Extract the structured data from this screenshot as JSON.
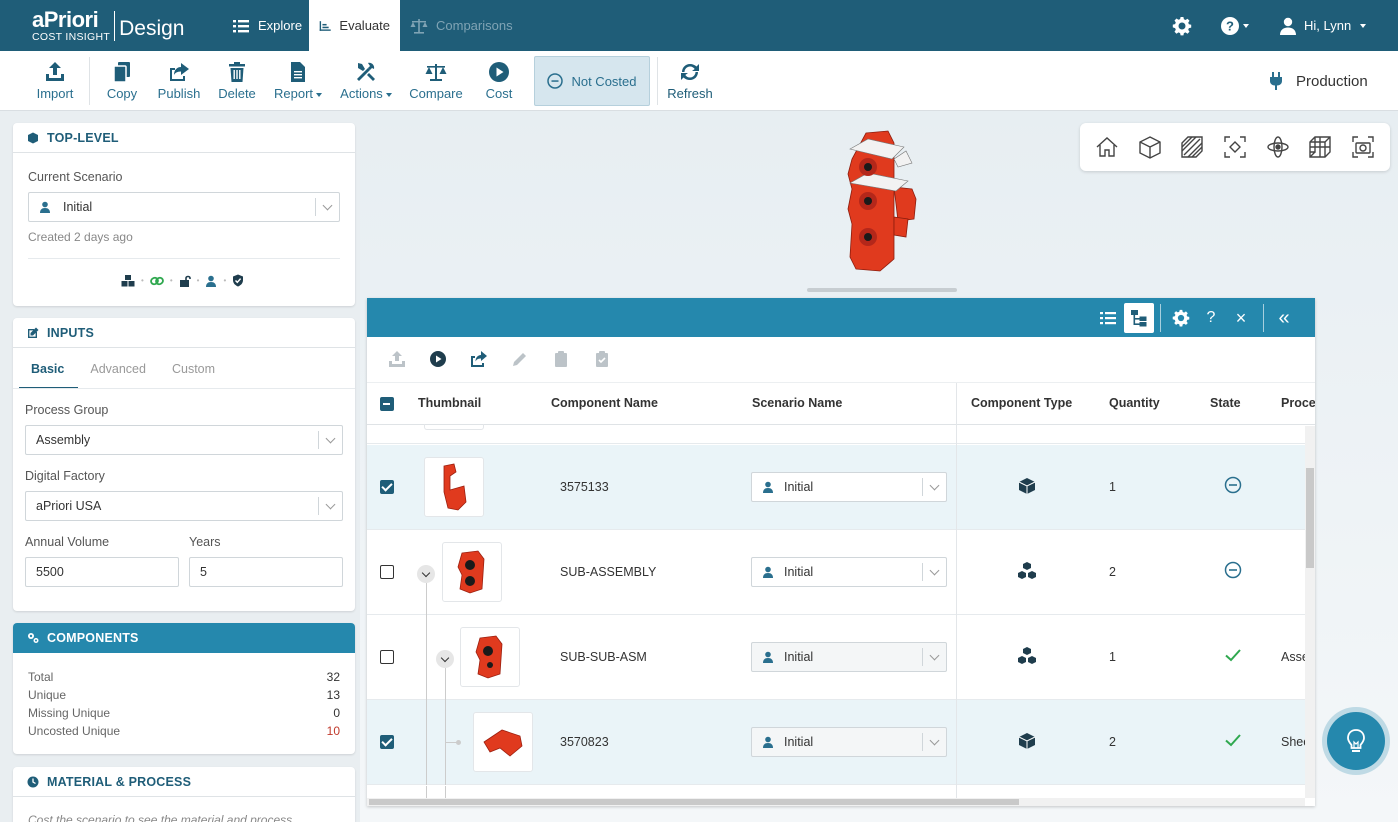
{
  "nav": {
    "brand_name": "aPriori",
    "brand_sub": "COST INSIGHT",
    "brand_product": "Design",
    "tabs": [
      {
        "label": "Explore"
      },
      {
        "label": "Evaluate"
      },
      {
        "label": "Comparisons"
      }
    ],
    "user_label": "Hi, Lynn"
  },
  "toolbar": {
    "import": "Import",
    "copy": "Copy",
    "publish": "Publish",
    "delete": "Delete",
    "report": "Report",
    "actions": "Actions",
    "compare": "Compare",
    "cost": "Cost",
    "status": "Not Costed",
    "refresh": "Refresh",
    "deployment": "Production"
  },
  "top_level": {
    "title": "TOP-LEVEL",
    "current_scenario_label": "Current Scenario",
    "current_scenario_value": "Initial",
    "created": "Created 2 days ago"
  },
  "inputs": {
    "title": "INPUTS",
    "tabs": [
      "Basic",
      "Advanced",
      "Custom"
    ],
    "process_group_label": "Process Group",
    "process_group_value": "Assembly",
    "digital_factory_label": "Digital Factory",
    "digital_factory_value": "aPriori USA",
    "annual_volume_label": "Annual Volume",
    "annual_volume_value": "5500",
    "years_label": "Years",
    "years_value": "5"
  },
  "components": {
    "title": "COMPONENTS",
    "rows": [
      {
        "label": "Total",
        "value": "32"
      },
      {
        "label": "Unique",
        "value": "13"
      },
      {
        "label": "Missing Unique",
        "value": "0"
      },
      {
        "label": "Uncosted Unique",
        "value": "10"
      }
    ]
  },
  "material_process": {
    "title": "MATERIAL & PROCESS",
    "hint": "Cost the scenario to see the material and process"
  },
  "table": {
    "headers": [
      "Thumbnail",
      "Component Name",
      "Scenario Name",
      "Component Type",
      "Quantity",
      "State",
      "Proce"
    ],
    "rows": [
      {
        "name": "3575133",
        "scenario": "Initial",
        "type": "part",
        "quantity": "1",
        "state": "not-costed",
        "process": "",
        "selected": true
      },
      {
        "name": "SUB-ASSEMBLY",
        "scenario": "Initial",
        "type": "assembly",
        "quantity": "2",
        "state": "not-costed",
        "process": "",
        "selected": false
      },
      {
        "name": "SUB-SUB-ASM",
        "scenario": "Initial",
        "type": "assembly",
        "quantity": "1",
        "state": "costed",
        "process": "Asse",
        "selected": false
      },
      {
        "name": "3570823",
        "scenario": "Initial",
        "type": "part",
        "quantity": "2",
        "state": "costed",
        "process": "Shee",
        "selected": true
      }
    ]
  },
  "colors": {
    "nav_bg": "#1f5d78",
    "accent": "#2588ad",
    "part_red": "#e03a1e",
    "success": "#2fa84f",
    "warning_text": "#c0392b"
  }
}
